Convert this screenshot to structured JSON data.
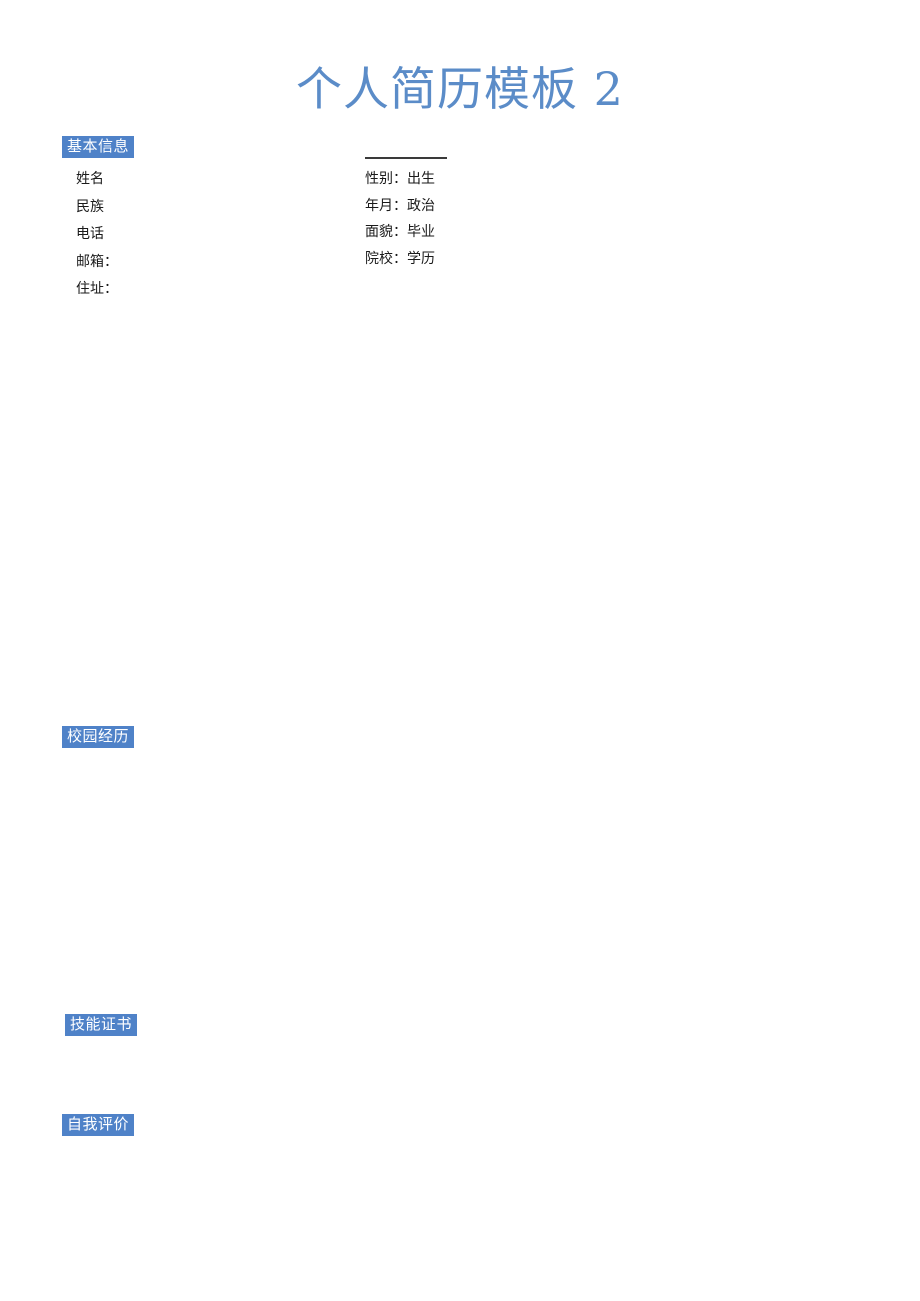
{
  "document": {
    "title": "个人简历模板 2",
    "title_color": "#5b8cc8",
    "accent_color": "#4f82c8",
    "background_color": "#ffffff",
    "text_color": "#1a1a1a"
  },
  "sections": {
    "basic_info": {
      "heading": "基本信息",
      "left_fields": [
        {
          "label": "姓名"
        },
        {
          "label": "民族"
        },
        {
          "label": "电话"
        },
        {
          "label": "邮箱："
        },
        {
          "label": "住址："
        }
      ],
      "right_fields": [
        {
          "label": "性别：出生"
        },
        {
          "label": "年月：政治"
        },
        {
          "label": "面貌：毕业"
        },
        {
          "label": "院校：学历"
        }
      ]
    },
    "campus_experience": {
      "heading": "校园经历",
      "content": ""
    },
    "skill_certificates": {
      "heading": "技能证书",
      "content": ""
    },
    "self_evaluation": {
      "heading": "自我评价",
      "content": ""
    }
  }
}
